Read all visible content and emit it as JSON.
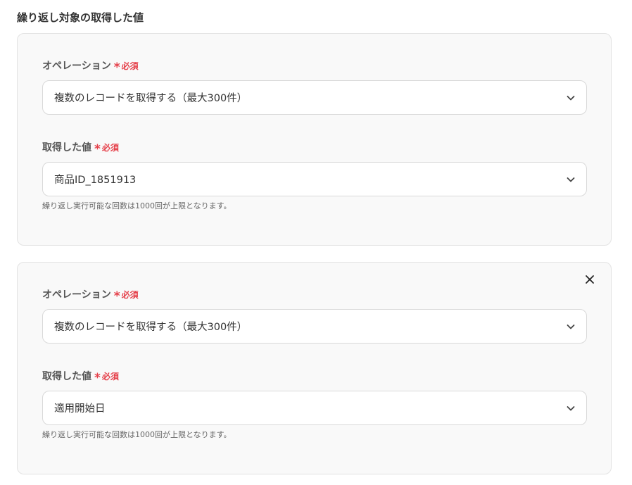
{
  "section": {
    "title": "繰り返し対象の取得した値"
  },
  "cards": [
    {
      "operation_label": "オペレーション",
      "required": "必須",
      "operation_value": "複数のレコードを取得する（最大300件）",
      "value_label": "取得した値",
      "value_value": "商品ID_1851913",
      "hint": "繰り返し実行可能な回数は1000回が上限となります。"
    },
    {
      "operation_label": "オペレーション",
      "required": "必須",
      "operation_value": "複数のレコードを取得する（最大300件）",
      "value_label": "取得した値",
      "value_value": "適用開始日",
      "hint": "繰り返し実行可能な回数は1000回が上限となります。"
    }
  ],
  "icons": {
    "dropdown": "chevron-down-icon",
    "remove": "close-icon",
    "required_mark": "asterisk-icon"
  },
  "colors": {
    "required": "#e5404a",
    "card_bg": "#f9f9f9",
    "border": "#d9d9d9"
  }
}
